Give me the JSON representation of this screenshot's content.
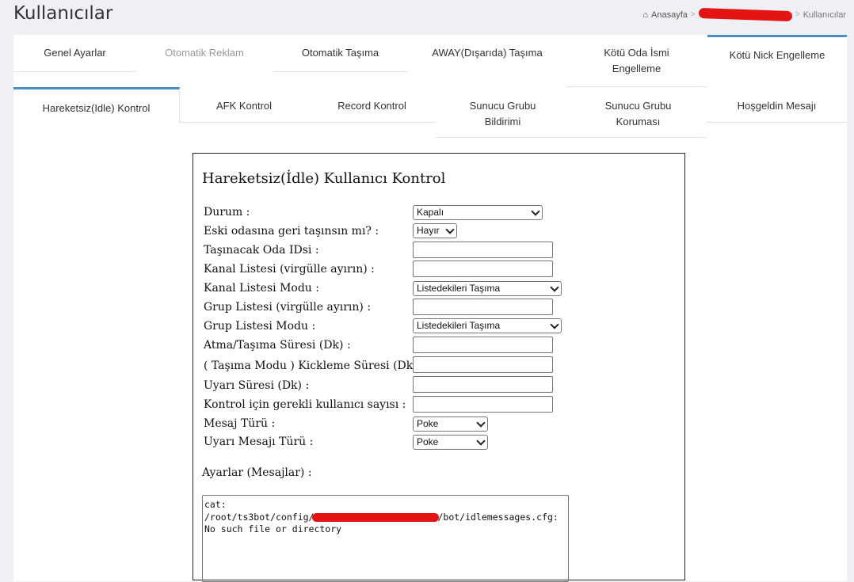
{
  "page": {
    "title": "Kullanıcılar"
  },
  "breadcrumb": {
    "home": "Anasayfa",
    "current": "Kullanıcılar"
  },
  "tabs_row1": [
    {
      "label": "Genel Ayarlar"
    },
    {
      "label": "Otomatik Reklam"
    },
    {
      "label": "Otomatik Taşıma"
    },
    {
      "label": "AWAY(Dışarıda) Taşıma"
    },
    {
      "label_line1": "Kötü Oda İsmi",
      "label_line2": "Engelleme"
    },
    {
      "label": "Kötü Nick Engelleme"
    }
  ],
  "tabs_row2": [
    {
      "label": "Hareketsiz(Idle) Kontrol"
    },
    {
      "label": "AFK Kontrol"
    },
    {
      "label": "Record Kontrol"
    },
    {
      "label_line1": "Sunucu Grubu",
      "label_line2": "Bildirimi"
    },
    {
      "label_line1": "Sunucu Grubu",
      "label_line2": "Koruması"
    },
    {
      "label": "Hoşgeldin Mesajı"
    }
  ],
  "form": {
    "title": "Hareketsiz(İdle) Kullanıcı Kontrol",
    "fields": [
      {
        "label": "Durum :",
        "value": "Kapalı"
      },
      {
        "label": "Eski odasına geri taşınsın mı? :",
        "value": "Hayır"
      },
      {
        "label": "Taşınacak Oda IDsi :",
        "value": ""
      },
      {
        "label": "Kanal Listesi (virgülle ayırın) :",
        "value": ""
      },
      {
        "label": "Kanal Listesi Modu :",
        "value": "Listedekileri Taşıma"
      },
      {
        "label": "Grup Listesi (virgülle ayırın) :",
        "value": ""
      },
      {
        "label": "Grup Listesi Modu :",
        "value": "Listedekileri Taşıma"
      },
      {
        "label": "Atma/Taşıma Süresi (Dk) :",
        "value": ""
      },
      {
        "label": "( Taşıma Modu ) Kickleme Süresi (Dk) :",
        "value": ""
      },
      {
        "label": "Uyarı Süresi (Dk) :",
        "value": ""
      },
      {
        "label": "Kontrol için gerekli kullanıcı sayısı :",
        "value": ""
      },
      {
        "label": "Mesaj Türü :",
        "value": "Poke"
      },
      {
        "label": "Uyarı Mesajı Türü :",
        "value": "Poke"
      }
    ],
    "settings_label": "Ayarlar (Mesajlar) :",
    "messages": {
      "line1": "cat:",
      "line2_start": "/root/ts3bot/config/",
      "line2_end": "/bot/idlemessages.cfg:",
      "line3": "No such file or directory"
    }
  }
}
